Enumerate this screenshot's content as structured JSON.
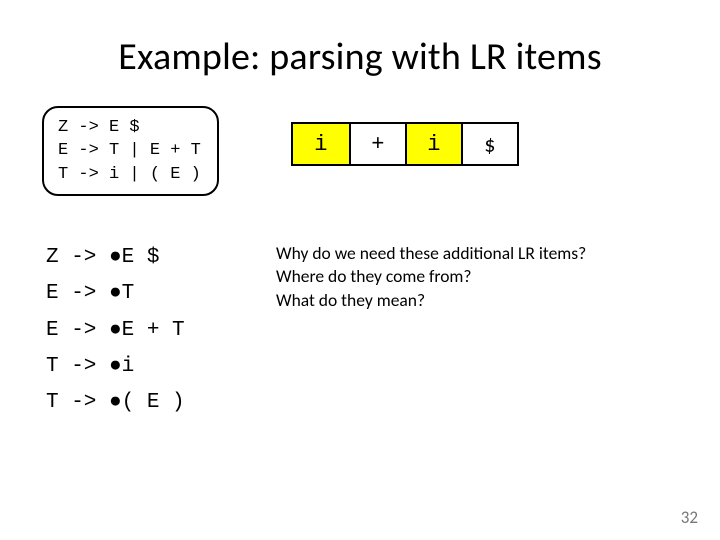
{
  "title": "Example: parsing with LR items",
  "grammar": "Z -> E $\nE -> T | E + T\nT -> i | ( E )",
  "parse_cells": [
    "i",
    "+",
    "i",
    "$"
  ],
  "lr_items": "Z -> ●E $\nE -> ●T\nE -> ●E + T\nT -> ●i\nT -> ●( E )",
  "questions": {
    "q1": "Why do we need these additional LR items?",
    "q2": "Where do they come from?",
    "q3": "What do they mean?"
  },
  "slide_number": "32"
}
